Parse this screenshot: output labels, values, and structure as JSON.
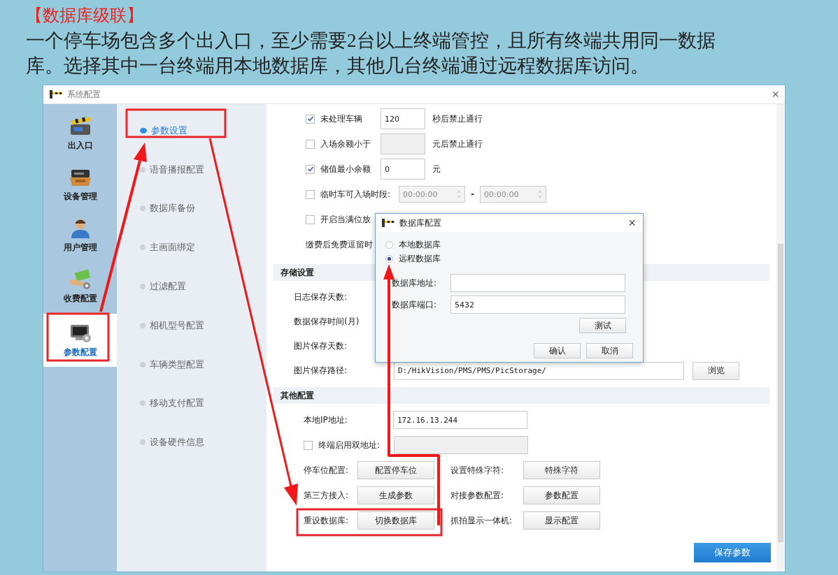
{
  "slide": {
    "title": "【数据库级联】",
    "body": "一个停车场包含多个出入口，至少需要2台以上终端管控，且所有终端共用同一数据库。选择其中一台终端用本地数据库，其他几台终端通过远程数据库访问。"
  },
  "window": {
    "title": "系统配置",
    "close": "×"
  },
  "nav": [
    {
      "label": "出入口",
      "selected": false
    },
    {
      "label": "设备管理",
      "selected": false
    },
    {
      "label": "用户管理",
      "selected": false
    },
    {
      "label": "收费配置",
      "selected": false
    },
    {
      "label": "参数配置",
      "selected": true
    }
  ],
  "submenu": [
    {
      "label": "参数设置",
      "selected": true
    },
    {
      "label": "语音播报配置",
      "selected": false
    },
    {
      "label": "数据库备份",
      "selected": false
    },
    {
      "label": "主画面绑定",
      "selected": false
    },
    {
      "label": "过滤配置",
      "selected": false
    },
    {
      "label": "相机型号配置",
      "selected": false
    },
    {
      "label": "车辆类型配置",
      "selected": false
    },
    {
      "label": "移动支付配置",
      "selected": false
    },
    {
      "label": "设备硬件信息",
      "selected": false
    }
  ],
  "rows": [
    {
      "kind": "check-input",
      "checked": true,
      "label": "未处理车辆",
      "value": "120",
      "disabled": false,
      "suffix": "秒后禁止通行"
    },
    {
      "kind": "check-input",
      "checked": false,
      "label": "入场余额小于",
      "disabled": true,
      "suffix": "元后禁止通行"
    },
    {
      "kind": "check-input",
      "checked": true,
      "label": "储值最小余额",
      "value": "0",
      "disabled": false,
      "suffix": "元"
    },
    {
      "kind": "check-time",
      "checked": false,
      "label": "临时车可入场时段:",
      "from": "00:00:00",
      "separator": "-",
      "to": "00:00:00"
    },
    {
      "kind": "check",
      "checked": false,
      "label": "开启当满位放"
    },
    {
      "kind": "label",
      "label": "缴费后免费逗留时"
    }
  ],
  "storage": {
    "title": "存储设置",
    "rows": [
      {
        "kind": "label",
        "label": "日志保存天数:"
      },
      {
        "kind": "label",
        "label": "数据保存时间(月)"
      },
      {
        "kind": "label",
        "label": "图片保存天数:"
      },
      {
        "kind": "path",
        "label": "图片保存路径:",
        "value": "D:/HikVision/PMS/PMS/PicStorage/",
        "button": "浏览"
      }
    ]
  },
  "other": {
    "title": "其他配置",
    "rows": [
      {
        "kind": "input",
        "label": "本地IP地址:",
        "value": "172.16.13.244"
      },
      {
        "kind": "check-input",
        "checked": false,
        "label": "终端启用双地址:",
        "disabled": true
      }
    ],
    "buttons": [
      [
        {
          "label": "停车位配置:",
          "button": "配置停车位"
        },
        {
          "label": "设置特殊字符:",
          "button": "特殊字符"
        }
      ],
      [
        {
          "label": "第三方接入:",
          "button": "生成参数"
        },
        {
          "label": "对接参数配置:",
          "button": "参数配置"
        }
      ],
      [
        {
          "label": "重设数据库:",
          "button": "切换数据库"
        },
        {
          "label": "抓拍显示一体机:",
          "button": "显示配置"
        }
      ]
    ]
  },
  "save": "保存参数",
  "dialog": {
    "title": "数据库配置",
    "close": "×",
    "options": [
      {
        "label": "本地数据库",
        "selected": false
      },
      {
        "label": "远程数据库",
        "selected": true
      }
    ],
    "fields": [
      {
        "label": "数据库地址:"
      },
      {
        "label": "数据库端口:",
        "value": "5432"
      }
    ],
    "test": "测试",
    "buttons": [
      "确认",
      "取消"
    ]
  }
}
